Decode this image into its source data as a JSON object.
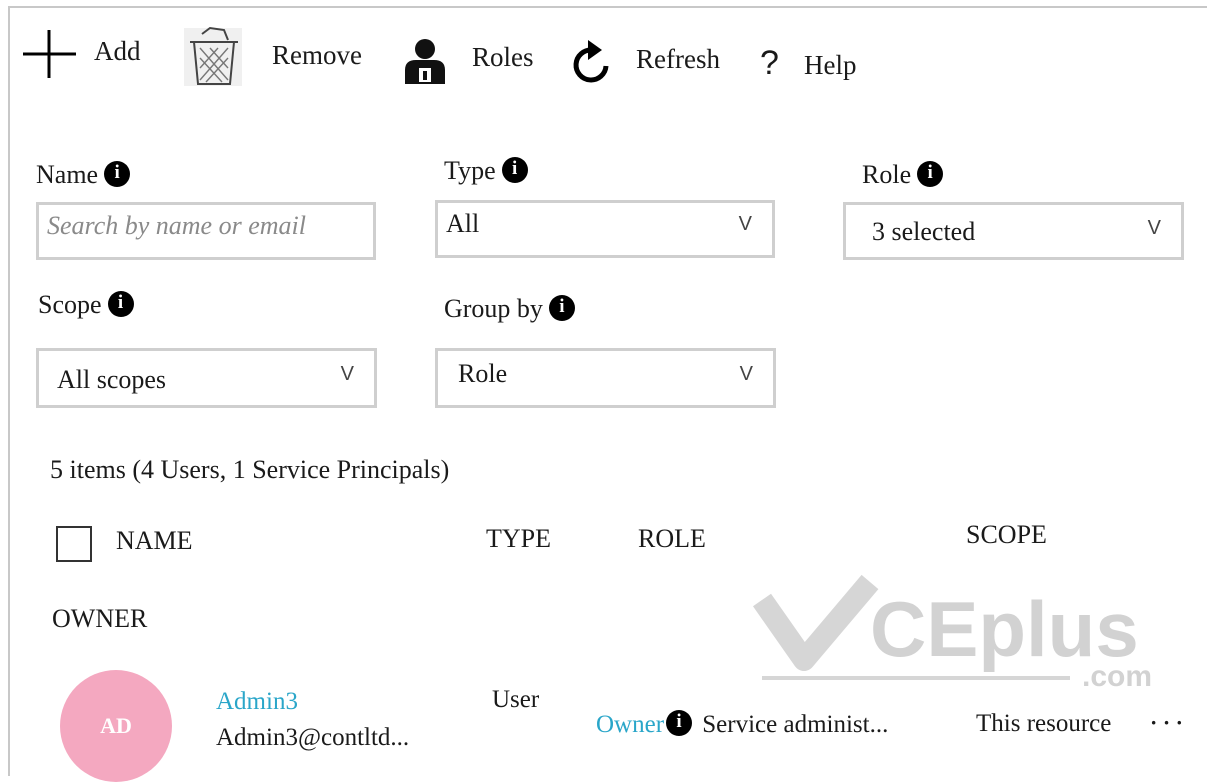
{
  "toolbar": {
    "add_label": "Add",
    "remove_label": "Remove",
    "roles_label": "Roles",
    "refresh_label": "Refresh",
    "help_label": "Help"
  },
  "filters": {
    "name_label": "Name",
    "name_placeholder": "Search by name or email",
    "type_label": "Type",
    "type_value": "All",
    "role_label": "Role",
    "role_value": "3 selected",
    "scope_label": "Scope",
    "scope_value": "All scopes",
    "groupby_label": "Group by",
    "groupby_value": "Role",
    "chevron": "V"
  },
  "summary": "5 items (4 Users, 1 Service Principals)",
  "table": {
    "columns": [
      "NAME",
      "TYPE",
      "ROLE",
      "SCOPE"
    ],
    "group_header": "OWNER",
    "rows": [
      {
        "avatar_initials": "AD",
        "name": "Admin3",
        "email": "Admin3@contltd...",
        "type": "User",
        "role": "Owner",
        "role_detail": "Service administ...",
        "scope": "This resource",
        "more": "· · ·"
      }
    ]
  },
  "watermark": {
    "text": "CEplus",
    "suffix": ".com"
  },
  "colors": {
    "link": "#2aa6c9",
    "avatar": "#f4a8c0",
    "border": "#cfcfcf"
  }
}
